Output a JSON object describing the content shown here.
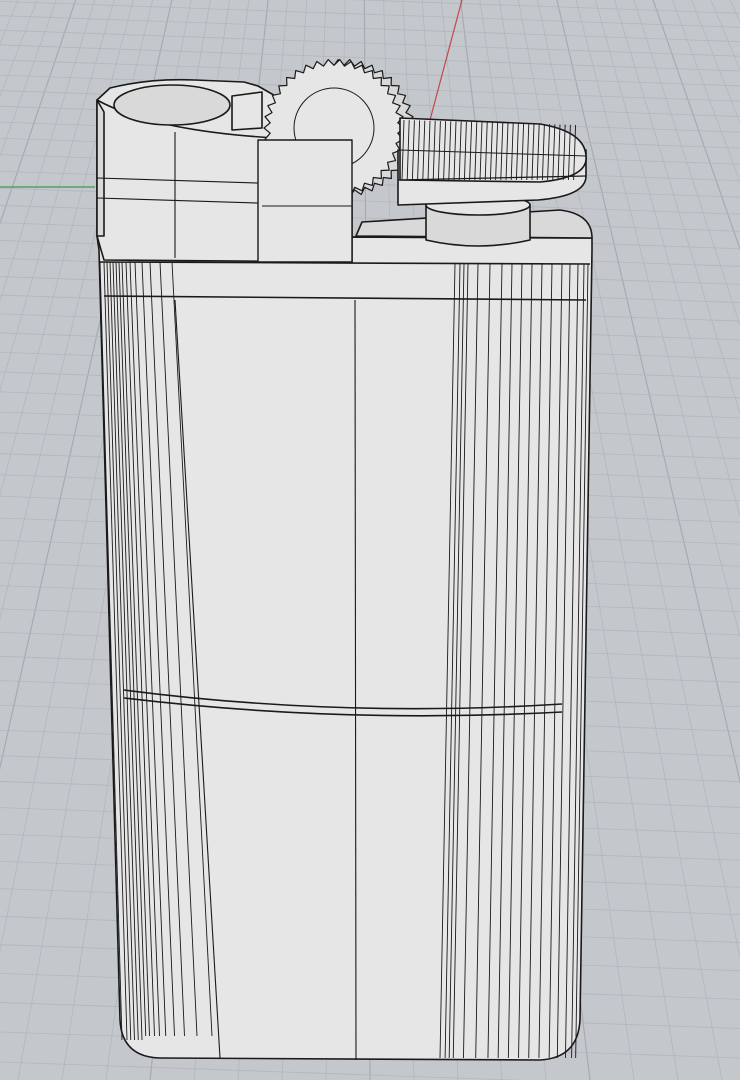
{
  "viewport": {
    "projection": "perspective",
    "grid": "on",
    "colors": {
      "background": "#c4c7cc",
      "grid_minor": "#b3b7bd",
      "grid_major": "#a6abb2",
      "x_axis": "#c04848",
      "y_axis": "#3c9a4a",
      "surface": "#e6e6e6",
      "surface_shade": "#d9d9d9",
      "wire": "#1a1a1a"
    }
  },
  "model": {
    "object": "lighter",
    "display_mode": "wireframe-shaded"
  }
}
